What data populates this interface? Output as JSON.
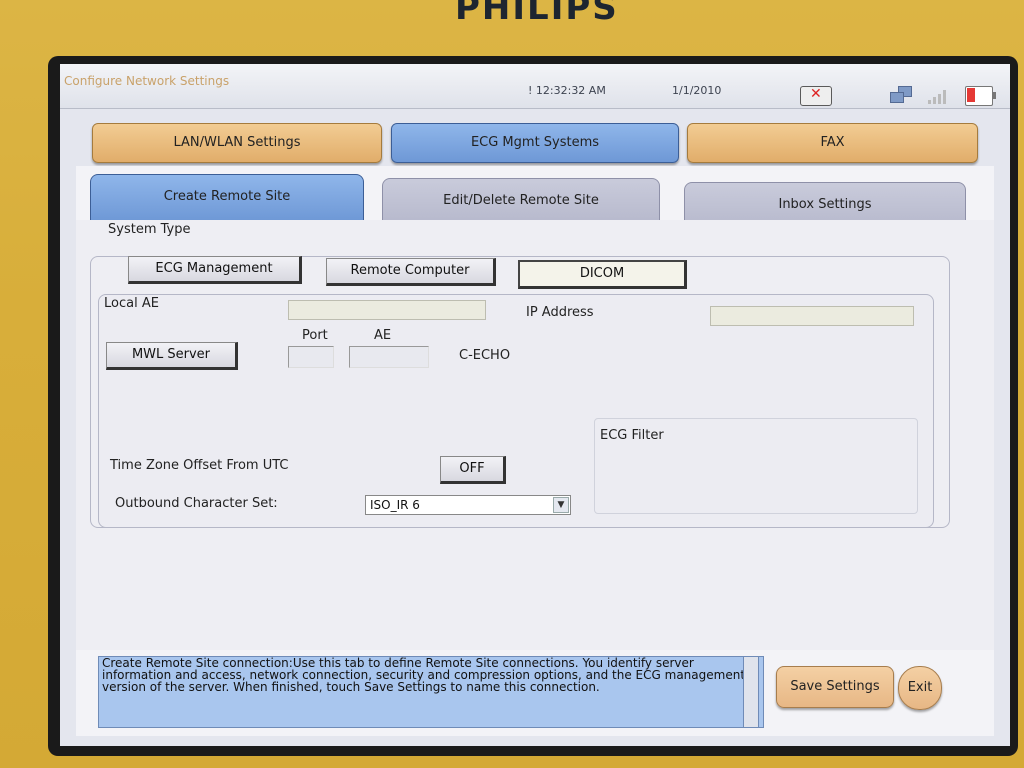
{
  "device": {
    "brand": "PHILIPS"
  },
  "titlebar": {
    "title": "Configure Network Settings",
    "time": "! 12:32:32 AM",
    "date": "1/1/2010",
    "icons": [
      "network-disconnected-icon",
      "lan-icon",
      "signal-strength-icon",
      "battery-icon"
    ]
  },
  "top_tabs": [
    {
      "label": "LAN/WLAN Settings",
      "active": false
    },
    {
      "label": "ECG Mgmt Systems",
      "active": true
    },
    {
      "label": "FAX",
      "active": false
    }
  ],
  "sub_tabs": [
    {
      "label": "Create Remote Site",
      "active": true
    },
    {
      "label": "Edit/Delete Remote Site",
      "active": false
    },
    {
      "label": "Inbox Settings",
      "active": false
    }
  ],
  "system_type": {
    "label": "System Type",
    "options": [
      "ECG Management",
      "Remote Computer",
      "DICOM"
    ],
    "selected": "DICOM"
  },
  "form": {
    "local_ae_label": "Local AE",
    "local_ae_value": "",
    "ip_address_label": "IP Address",
    "ip_address_value": "",
    "mwl_server_button": "MWL Server",
    "port_label": "Port",
    "port_value": "",
    "ae_label": "AE",
    "ae_value": "",
    "c_echo_label": "C-ECHO",
    "ecg_filter_label": "ECG Filter",
    "tz_label": "Time Zone Offset From UTC",
    "tz_value": "OFF",
    "charset_label": "Outbound Character Set:",
    "charset_value": "ISO_IR 6"
  },
  "help_text": "Create Remote Site connection:Use this tab to define Remote Site connections. You identify server information and access, network connection, security and compression options, and the ECG management version of the server. When finished, touch Save Settings to name this connection.",
  "actions": {
    "save": "Save Settings",
    "exit": "Exit"
  }
}
